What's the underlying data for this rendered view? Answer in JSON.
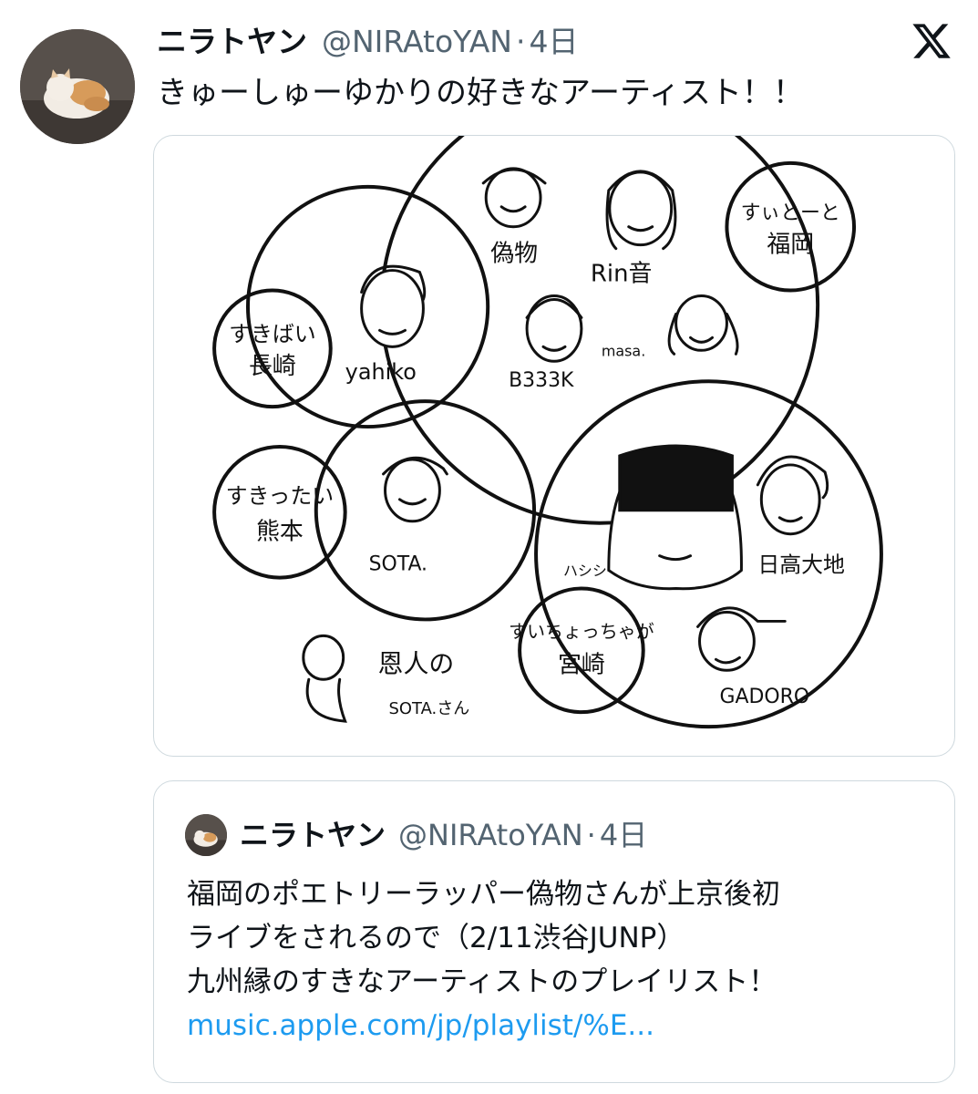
{
  "tweet": {
    "author_name": "ニラトヤン",
    "handle": "@NIRAtoYAN",
    "separator": "·",
    "time": "4日",
    "text": "きゅーしゅーゆかりの好きなアーティスト！！"
  },
  "illustration": {
    "labels": {
      "nisemono": "偽物",
      "rinne": "Rin音",
      "sweet_fukuoka_1": "すぃとーと",
      "sweet_fukuoka_2": "福岡",
      "sukibai_1": "すきばい",
      "sukibai_2": "長崎",
      "yahiko": "yahiko",
      "b333k": "B333K",
      "masa": "masa.",
      "sukittai_1": "すきったい",
      "sukittai_2": "熊本",
      "sota": "SOTA.",
      "hashishi": "ハシシ",
      "hidaka": "日高大地",
      "suichoccha_1": "すいちょっちゃが",
      "suichoccha_2": "宮崎",
      "gadoro": "GADORO",
      "onjin": "恩人の",
      "sota_san": "SOTA.さん"
    }
  },
  "quote": {
    "author_name": "ニラトヤン",
    "handle": "@NIRAtoYAN",
    "separator": "·",
    "time": "4日",
    "lines": [
      "福岡のポエトリーラッパー偽物さんが上京後初",
      "ライブをされるので（2/11渋谷JUNP）",
      "九州縁のすきなアーティストのプレイリスト！"
    ],
    "link": "music.apple.com/jp/playlist/%E..."
  },
  "colors": {
    "link": "#1d9bf0",
    "secondary": "#536471",
    "border": "#cfd9de"
  },
  "icons": {
    "logo": "x-logo-icon"
  }
}
